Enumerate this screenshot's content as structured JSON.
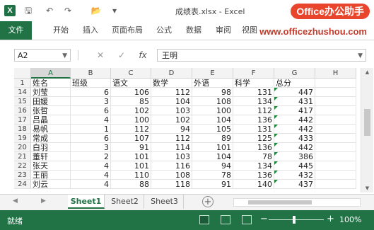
{
  "titlebar": {
    "app_icon": "X",
    "qat_icons": [
      "save-icon",
      "undo-icon",
      "redo-icon",
      "open-icon",
      "customize-icon"
    ],
    "title": "成绩表.xlsx - Excel",
    "brand": "Office办公助手"
  },
  "ribbon": {
    "tabs": [
      "文件",
      "开始",
      "插入",
      "页面布局",
      "公式",
      "数据",
      "审阅",
      "视图"
    ],
    "watermark": "www.officezhushou.com"
  },
  "formula_bar": {
    "name_box": "A2",
    "buttons": [
      "✕",
      "✓",
      "fx"
    ],
    "value": "王明"
  },
  "sheet": {
    "columns": [
      "A",
      "B",
      "C",
      "D",
      "E",
      "F",
      "G",
      "H"
    ],
    "selected_column": "A",
    "header_row": {
      "row": "1",
      "cells": [
        "姓名",
        "班级",
        "语文",
        "数学",
        "外语",
        "科学",
        "总分",
        ""
      ]
    },
    "rows": [
      {
        "row": "14",
        "cells": [
          "刘莹",
          "6",
          "106",
          "112",
          "98",
          "131",
          "447",
          ""
        ]
      },
      {
        "row": "15",
        "cells": [
          "田媛",
          "3",
          "85",
          "104",
          "108",
          "134",
          "431",
          ""
        ]
      },
      {
        "row": "16",
        "cells": [
          "张哲",
          "6",
          "102",
          "103",
          "100",
          "112",
          "417",
          ""
        ]
      },
      {
        "row": "17",
        "cells": [
          "吕晶",
          "4",
          "100",
          "102",
          "104",
          "136",
          "442",
          ""
        ]
      },
      {
        "row": "18",
        "cells": [
          "易帆",
          "1",
          "112",
          "94",
          "105",
          "131",
          "442",
          ""
        ]
      },
      {
        "row": "19",
        "cells": [
          "常成",
          "6",
          "107",
          "112",
          "89",
          "125",
          "433",
          ""
        ]
      },
      {
        "row": "20",
        "cells": [
          "白羽",
          "3",
          "91",
          "114",
          "101",
          "136",
          "442",
          ""
        ]
      },
      {
        "row": "21",
        "cells": [
          "董轩",
          "2",
          "101",
          "103",
          "104",
          "78",
          "386",
          ""
        ]
      },
      {
        "row": "22",
        "cells": [
          "张天",
          "4",
          "101",
          "116",
          "94",
          "134",
          "445",
          ""
        ]
      },
      {
        "row": "23",
        "cells": [
          "王丽",
          "4",
          "110",
          "108",
          "78",
          "136",
          "432",
          ""
        ]
      },
      {
        "row": "24",
        "cells": [
          "刘云",
          "4",
          "88",
          "118",
          "91",
          "140",
          "437",
          ""
        ]
      }
    ]
  },
  "sheet_tabs": [
    "Sheet1",
    "Sheet2",
    "Sheet3"
  ],
  "active_sheet": "Sheet1",
  "status": {
    "text": "就绪",
    "zoom": "100%"
  },
  "colors": {
    "excel_green": "#217346",
    "brand_red": "#e8452c",
    "watermark_red": "#c23a2a"
  }
}
